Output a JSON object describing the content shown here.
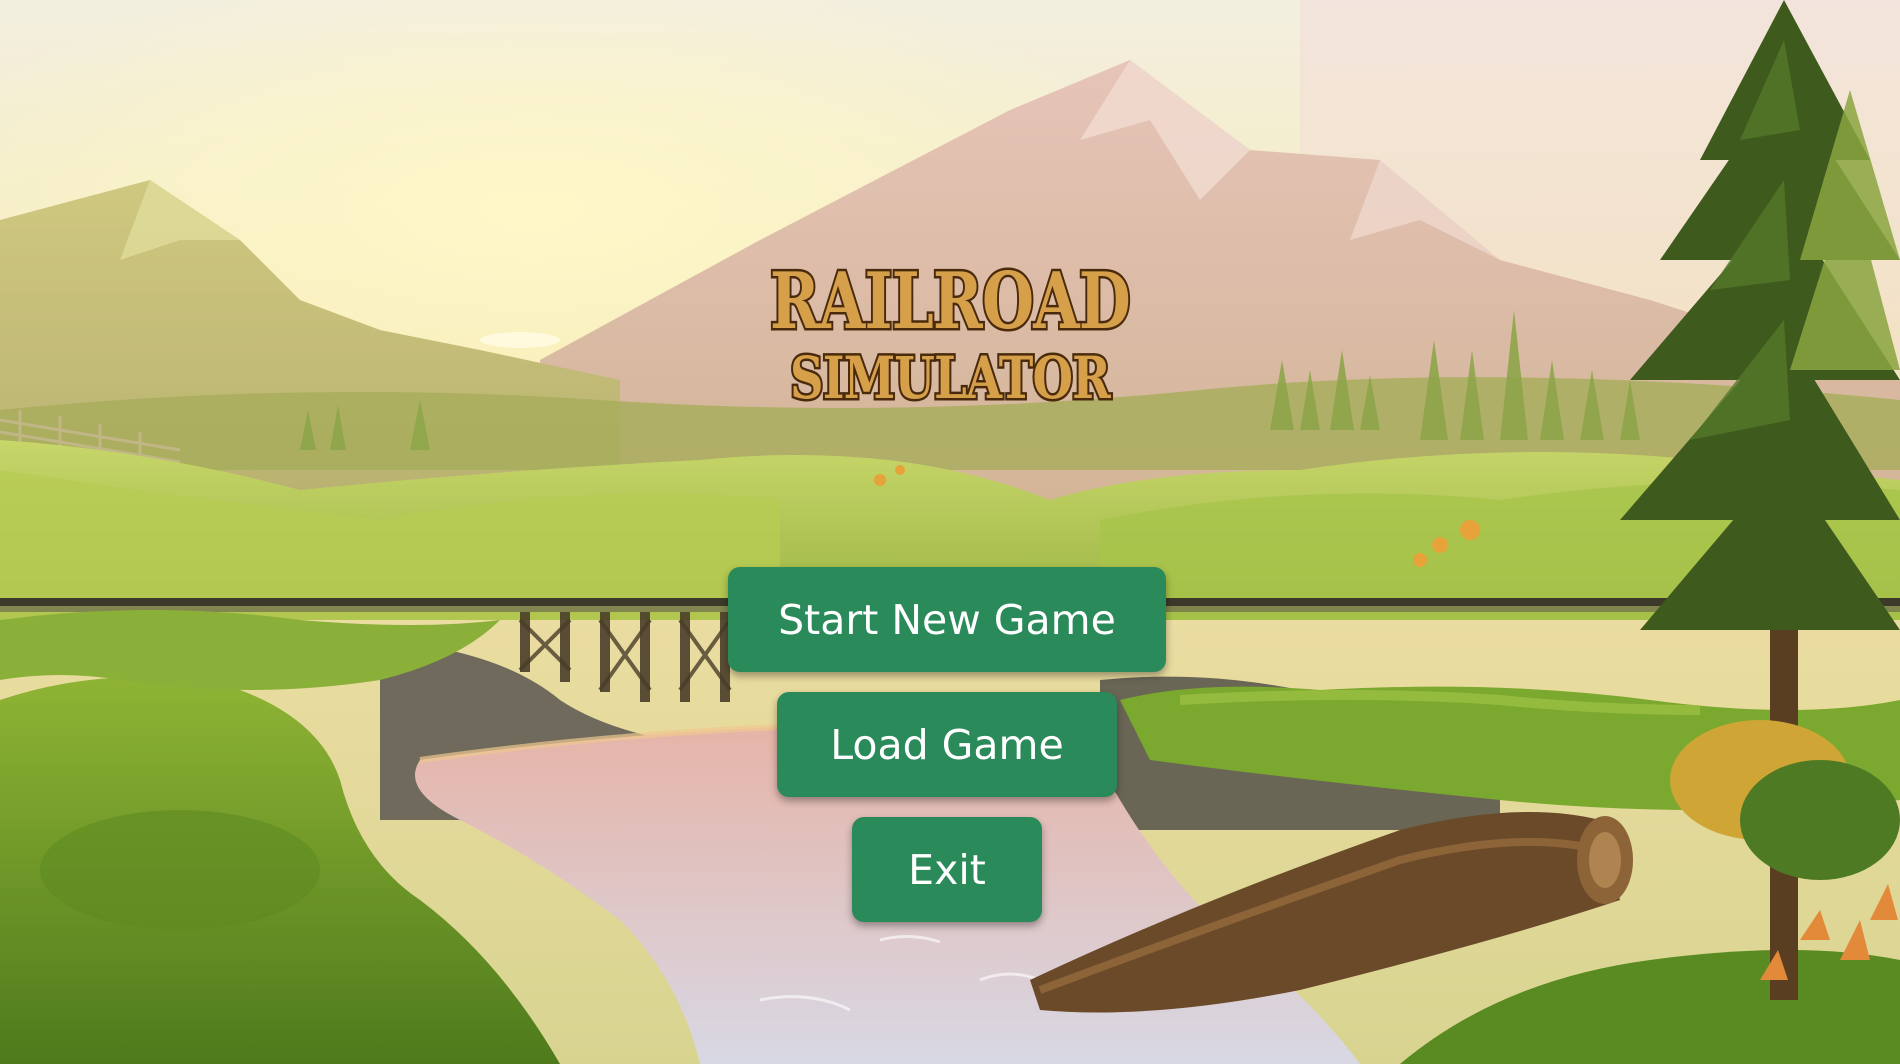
{
  "game": {
    "logo": {
      "line1": "RAILROAD",
      "line2": "SIMULATOR"
    },
    "menu": {
      "start_label": "Start New Game",
      "load_label": "Load Game",
      "exit_label": "Exit"
    },
    "colors": {
      "button_bg": "#2a8a5a",
      "button_text": "#ffffff",
      "logo_fill": "#d6a04a",
      "logo_outline": "#4a2a0c"
    }
  }
}
